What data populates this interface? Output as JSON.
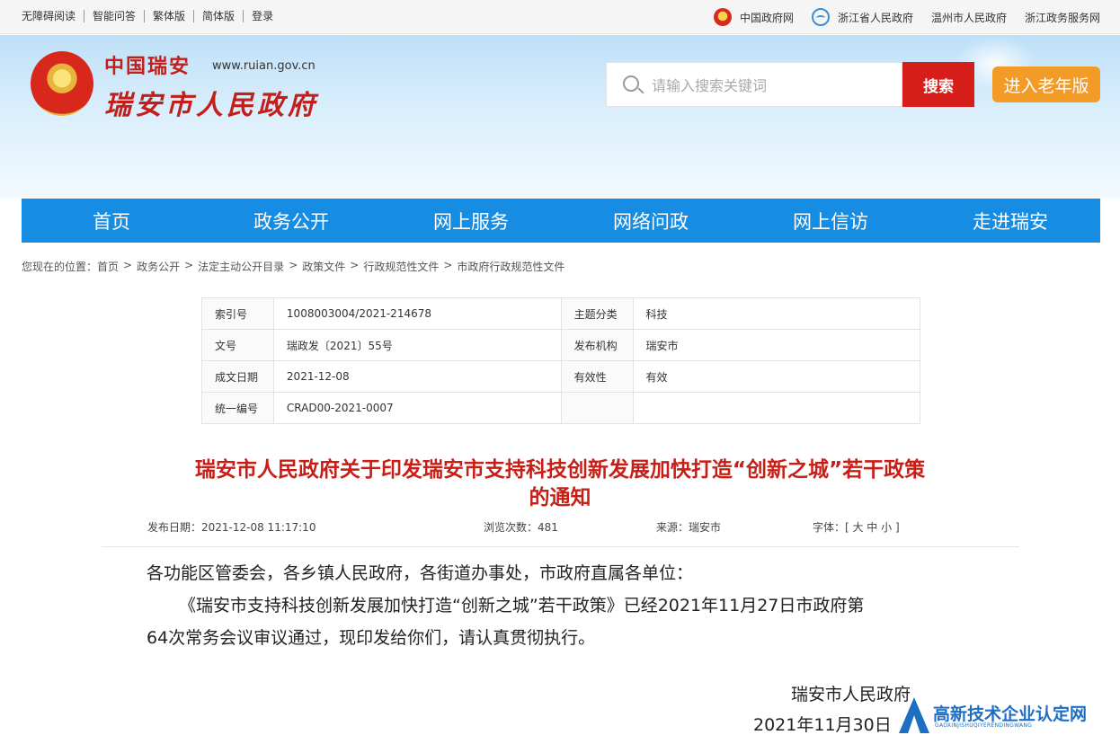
{
  "topbar": {
    "left": [
      "无障碍阅读",
      "智能问答",
      "繁体版",
      "简体版",
      "登录"
    ],
    "right": [
      "中国政府网",
      "浙江省人民政府",
      "温州市人民政府",
      "浙江政务服务网"
    ]
  },
  "header": {
    "logo_small": "中国瑞安",
    "logo_url": "www.ruian.gov.cn",
    "logo_big": "瑞安市人民政府",
    "search_placeholder": "请输入搜索关键词",
    "search_button": "搜索",
    "elder_button": "进入老年版"
  },
  "nav": [
    "首页",
    "政务公开",
    "网上服务",
    "网络问政",
    "网上信访",
    "走进瑞安"
  ],
  "breadcrumb": {
    "prefix": "您现在的位置：",
    "items": [
      "首页",
      "政务公开",
      "法定主动公开目录",
      "政策文件",
      "行政规范性文件",
      "市政府行政规范性文件"
    ],
    "sep": ">"
  },
  "meta": {
    "index_no_label": "索引号",
    "index_no": "1008003004/2021-214678",
    "topic_label": "主题分类",
    "topic": "科技",
    "doc_no_label": "文号",
    "doc_no": "瑞政发〔2021〕55号",
    "issuer_label": "发布机构",
    "issuer": "瑞安市",
    "date_label": "成文日期",
    "date": "2021-12-08",
    "validity_label": "有效性",
    "validity": "有效",
    "uid_label": "统一编号",
    "uid": "CRAD00-2021-0007"
  },
  "article": {
    "title_line1": "瑞安市人民政府关于印发瑞安市支持科技创新发展加快打造“创新之城”若干政策",
    "title_line2": "的通知",
    "publish": "发布日期：2021-12-08 11:17:10",
    "views": "浏览次数：481",
    "source": "来源：瑞安市",
    "fontsize": "字体：[ 大 中 小 ]",
    "p1": "各功能区管委会，各乡镇人民政府，各街道办事处，市政府直属各单位：",
    "p2a": "《瑞安市支持科技创新发展加快打造“创新之城”若干政策》已经2021年11月27日市政府第",
    "p2b": "64次常务会议审议通过，现印发给你们，请认真贯彻执行。",
    "sign_org": "瑞安市人民政府",
    "sign_date": "2021年11月30日"
  },
  "watermark": {
    "text": "高新技术企业认定网",
    "sub": "GAOXINJISHUQIYERENDINGWANG"
  },
  "colors": {
    "nav_blue": "#168de2",
    "title_red": "#c91e16",
    "search_red": "#d61f1a",
    "elder_orange": "#f29b27"
  }
}
